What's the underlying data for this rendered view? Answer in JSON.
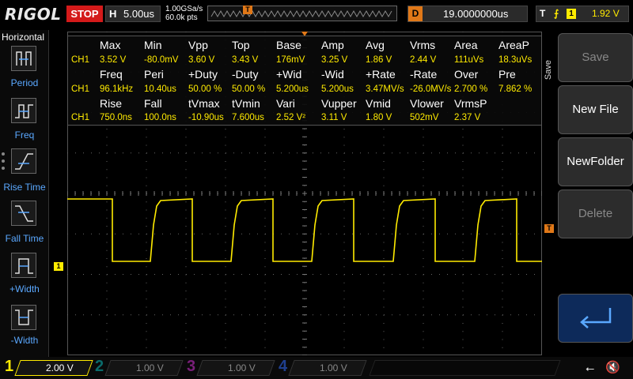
{
  "top": {
    "logo": "RIGOL",
    "run_state": "STOP",
    "horizontal_label": "H",
    "timebase": "5.00us",
    "sample_rate": "1.00GSa/s",
    "points": "60.0k pts",
    "trigger_pos_marker": "T",
    "delay_label": "D",
    "delay_value": "19.0000000us",
    "trigger_label": "T",
    "trigger_edge": "⨍",
    "trigger_channel": "1",
    "trigger_level": "1.92 V"
  },
  "left_menu": {
    "title": "Horizontal",
    "items": [
      "Period",
      "Freq",
      "Rise Time",
      "Fall Time",
      "+Width",
      "-Width"
    ]
  },
  "measurements": {
    "rows": [
      {
        "heads": [
          "Max",
          "Min",
          "Vpp",
          "Top",
          "Base",
          "Amp",
          "Avg",
          "Vrms",
          "Area",
          "AreaP"
        ],
        "ch": "CH1",
        "vals": [
          "3.52 V",
          "-80.0mV",
          "3.60 V",
          "3.43 V",
          "176mV",
          "3.25 V",
          "1.86 V",
          "2.44 V",
          "111uVs",
          "18.3uVs"
        ]
      },
      {
        "heads": [
          "Freq",
          "Peri",
          "+Duty",
          "-Duty",
          "+Wid",
          "-Wid",
          "+Rate",
          "-Rate",
          "Over",
          "Pre"
        ],
        "ch": "CH1",
        "vals": [
          "96.1kHz",
          "10.40us",
          "50.00 %",
          "50.00 %",
          "5.200us",
          "5.200us",
          "3.47MV/s",
          "-26.0MV/s",
          "2.700 %",
          "7.862 %"
        ]
      },
      {
        "heads": [
          "Rise",
          "Fall",
          "tVmax",
          "tVmin",
          "Vari",
          "Vupper",
          "Vmid",
          "Vlower",
          "VrmsP",
          ""
        ],
        "ch": "CH1",
        "vals": [
          "750.0ns",
          "100.0ns",
          "-10.90us",
          "7.600us",
          "2.52 V²",
          "3.11 V",
          "1.80 V",
          "502mV",
          "2.37 V",
          ""
        ]
      }
    ]
  },
  "markers": {
    "ch1": "1",
    "trigger": "T"
  },
  "right_menu": {
    "side_label": "Save",
    "buttons": [
      {
        "label": "Save",
        "enabled": false
      },
      {
        "label": "New File",
        "enabled": true
      },
      {
        "label": "NewFolder",
        "enabled": true
      },
      {
        "label": "Delete",
        "enabled": false
      }
    ],
    "enter_icon": "enter-arrow-icon"
  },
  "channels": [
    {
      "num": "1",
      "scale": "2.00 V",
      "color": "#ffeb00",
      "active": true
    },
    {
      "num": "2",
      "scale": "1.00 V",
      "color": "#00d8d8",
      "active": false
    },
    {
      "num": "3",
      "scale": "1.00 V",
      "color": "#e040e0",
      "active": false
    },
    {
      "num": "4",
      "scale": "1.00 V",
      "color": "#3070ff",
      "active": false
    }
  ],
  "status_icons": [
    "usb-icon",
    "speaker-muted-icon"
  ],
  "colors": {
    "ch1": "#ffeb00",
    "trigger": "#e07818",
    "stop": "#d41a1a",
    "menu_text": "#5aa8ff"
  }
}
